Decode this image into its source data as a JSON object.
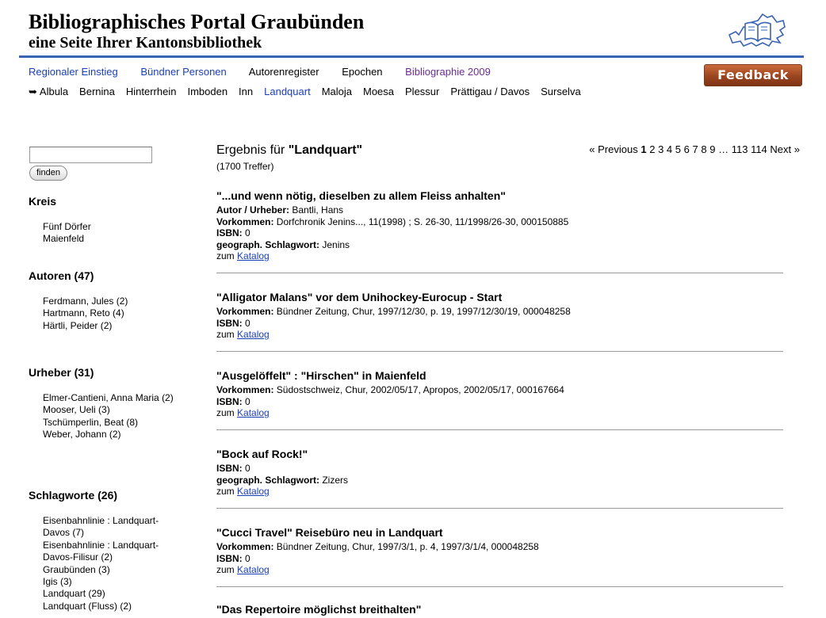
{
  "header": {
    "title": "Bibliographisches Portal Graubünden",
    "subtitle": "eine Seite Ihrer Kantonsbibliothek"
  },
  "mainnav": [
    {
      "label": "Regionaler Einstieg",
      "color": "#1a3fb8"
    },
    {
      "label": "Bündner Personen",
      "color": "#1a3fb8"
    },
    {
      "label": "Autorenregister",
      "color": "#000000"
    },
    {
      "label": "Epochen",
      "color": "#000000"
    },
    {
      "label": "Bibliographie 2009",
      "color": "#6a2c91"
    }
  ],
  "subnav": {
    "arrow": "➥",
    "items": [
      "Albula",
      "Bernina",
      "Hinterrhein",
      "Imboden",
      "Inn",
      "Landquart",
      "Maloja",
      "Moesa",
      "Plessur",
      "Prättigau / Davos",
      "Surselva"
    ],
    "active": "Landquart"
  },
  "feedback": {
    "label": "Feedback"
  },
  "search": {
    "value": "",
    "button_label": "finden"
  },
  "facets": {
    "kreis": {
      "heading": "Kreis",
      "items": [
        "Fünf Dörfer",
        "Maienfeld"
      ]
    },
    "autoren": {
      "heading": "Autoren (47)",
      "items": [
        "Ferdmann, Jules (2)",
        "Hartmann, Reto (4)",
        "Härtli, Peider (2)"
      ]
    },
    "urheber": {
      "heading": "Urheber (31)",
      "items": [
        "Elmer-Cantieni, Anna Maria (2)",
        "Mooser, Ueli (3)",
        "Tschümperlin, Beat (8)",
        "Weber, Johann (2)"
      ]
    },
    "schlagworte": {
      "heading": "Schlagworte (26)",
      "items": [
        "Eisenbahnlinie : Landquart-Davos (7)",
        "Eisenbahnlinie : Landquart-Davos-Filisur (2)",
        "Graubünden (3)",
        "Igis (3)",
        "Landquart (29)",
        "Landquart (Fluss) (2)"
      ]
    }
  },
  "results": {
    "prefix": "Ergebnis für ",
    "query": "\"Landquart\"",
    "count": "(1700 Treffer)",
    "pagination": {
      "previous": "« Previous",
      "pages": [
        "1",
        "2",
        "3",
        "4",
        "5",
        "6",
        "7",
        "8",
        "9"
      ],
      "ellipsis": "…",
      "last_pages": [
        "113",
        "114"
      ],
      "next": "Next »"
    },
    "catalog_prefix": "zum ",
    "catalog_link": "Katalog",
    "items": [
      {
        "title": "\"...und wenn nötig, dieselben zu allem Fleiss anhalten\"",
        "fields": [
          {
            "label": "Autor / Urheber:",
            "value": " Bantli, Hans"
          },
          {
            "label": "Vorkommen:",
            "value": " Dorfchronik Jenins..., 11(1998) ; S. 26-30, 11/1998/26-30, 000150885"
          },
          {
            "label": "ISBN:",
            "value": " 0"
          },
          {
            "label": "geograph. Schlagwort:",
            "value": " Jenins"
          }
        ]
      },
      {
        "title": "\"Alligator Malans\" vor dem Unihockey-Eurocup - Start",
        "fields": [
          {
            "label": "Vorkommen:",
            "value": " Bündner Zeitung, Chur, 1997/12/30, p. 19, 1997/12/30/19, 000048258"
          },
          {
            "label": "ISBN:",
            "value": " 0"
          }
        ]
      },
      {
        "title": "\"Ausgelöffelt\" : \"Hirschen\" in Maienfeld",
        "fields": [
          {
            "label": "Vorkommen:",
            "value": " Südostschweiz, Chur, 2002/05/17, Apropos, 2002/05/17, 000167664"
          },
          {
            "label": "ISBN:",
            "value": " 0"
          }
        ]
      },
      {
        "title": "\"Bock auf Rock!\"",
        "fields": [
          {
            "label": "ISBN:",
            "value": " 0"
          },
          {
            "label": "geograph. Schlagwort:",
            "value": " Zizers"
          }
        ]
      },
      {
        "title": "\"Cucci Travel\" Reisebüro neu in Landquart",
        "fields": [
          {
            "label": "Vorkommen:",
            "value": " Bündner Zeitung, Chur, 1997/3/1, p. 4, 1997/3/1/4, 000048258"
          },
          {
            "label": "ISBN:",
            "value": " 0"
          }
        ]
      },
      {
        "title": "\"Das Repertoire möglichst breithalten\"",
        "fields": []
      }
    ]
  }
}
